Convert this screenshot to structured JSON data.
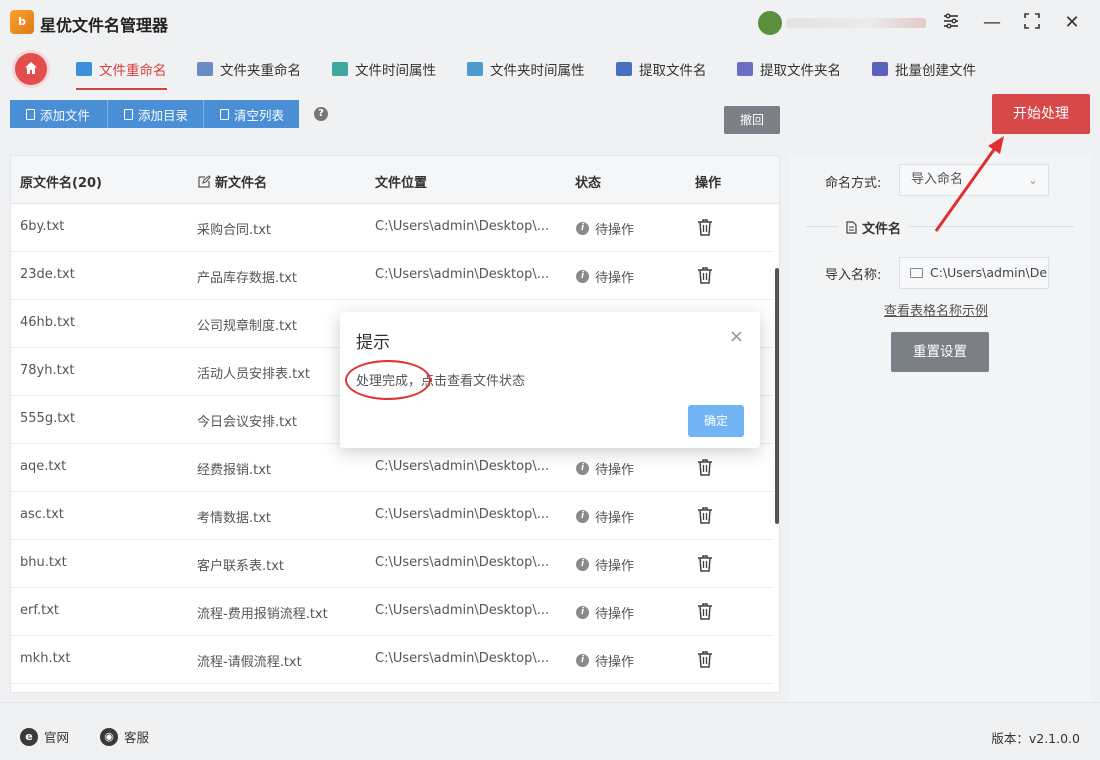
{
  "app": {
    "logo_text": "b",
    "title": "星优文件名管理器"
  },
  "window": {
    "settings_glyph": "⚙",
    "minimize_glyph": "—",
    "maximize_glyph": "⛶",
    "close_glyph": "✕"
  },
  "tabs": [
    {
      "label": "文件重命名",
      "icon": "file-rename-icon",
      "color": "#3b8fdc"
    },
    {
      "label": "文件夹重命名",
      "icon": "folder-rename-icon",
      "color": "#6a8bc3"
    },
    {
      "label": "文件时间属性",
      "icon": "file-time-icon",
      "color": "#3fa7a0"
    },
    {
      "label": "文件夹时间属性",
      "icon": "folder-time-icon",
      "color": "#4e9bd1"
    },
    {
      "label": "提取文件名",
      "icon": "extract-filename-icon",
      "color": "#4a6fc0"
    },
    {
      "label": "提取文件夹名",
      "icon": "extract-foldername-icon",
      "color": "#6b6ec8"
    },
    {
      "label": "批量创建文件",
      "icon": "batch-create-icon",
      "color": "#5a62b9"
    }
  ],
  "toolbar": {
    "add_file": "添加文件",
    "add_dir": "添加目录",
    "clear_list": "清空列表",
    "help": "?",
    "undo": "撤回"
  },
  "table": {
    "headers": {
      "original": "原文件名(20)",
      "new": "新文件名",
      "location": "文件位置",
      "status": "状态",
      "action": "操作"
    },
    "rows": [
      {
        "original": "6by.txt",
        "new": "采购合同.txt",
        "location": "C:\\Users\\admin\\Desktop\\...",
        "status": "待操作"
      },
      {
        "original": "23de.txt",
        "new": "产品库存数据.txt",
        "location": "C:\\Users\\admin\\Desktop\\...",
        "status": "待操作"
      },
      {
        "original": "46hb.txt",
        "new": "公司规章制度.txt",
        "location": "",
        "status": ""
      },
      {
        "original": "78yh.txt",
        "new": "活动人员安排表.txt",
        "location": "",
        "status": ""
      },
      {
        "original": "555g.txt",
        "new": "今日会议安排.txt",
        "location": "",
        "status": ""
      },
      {
        "original": "aqe.txt",
        "new": "经费报销.txt",
        "location": "C:\\Users\\admin\\Desktop\\...",
        "status": "待操作"
      },
      {
        "original": "asc.txt",
        "new": "考情数据.txt",
        "location": "C:\\Users\\admin\\Desktop\\...",
        "status": "待操作"
      },
      {
        "original": "bhu.txt",
        "new": "客户联系表.txt",
        "location": "C:\\Users\\admin\\Desktop\\...",
        "status": "待操作"
      },
      {
        "original": "erf.txt",
        "new": "流程-费用报销流程.txt",
        "location": "C:\\Users\\admin\\Desktop\\...",
        "status": "待操作"
      },
      {
        "original": "mkh.txt",
        "new": "流程-请假流程.txt",
        "location": "C:\\Users\\admin\\Desktop\\...",
        "status": "待操作"
      }
    ]
  },
  "right": {
    "start_button": "开始处理",
    "naming_mode_label": "命名方式:",
    "naming_mode_value": "导入命名",
    "section_title": "文件名",
    "import_label": "导入名称:",
    "import_path": "C:\\Users\\admin\\De",
    "example_link": "查看表格名称示例",
    "reset_button": "重置设置"
  },
  "dialog": {
    "title": "提示",
    "message": "处理完成，点击查看文件状态",
    "ok": "确定",
    "close": "×"
  },
  "footer": {
    "website": "官网",
    "support": "客服",
    "version": "版本：v2.1.0.0"
  },
  "colors": {
    "accent_red": "#d94848",
    "toolbar_blue": "#4a8fd6",
    "dialog_ok": "#73b4f5",
    "annotation_red": "#e03030"
  }
}
